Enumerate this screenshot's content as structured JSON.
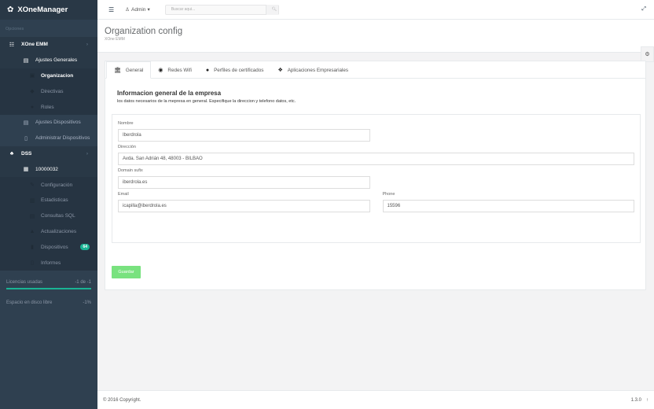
{
  "app": {
    "name": "XOneManager"
  },
  "sidebar": {
    "section_label": "Opciones",
    "items": [
      {
        "label": "XOne EMM"
      },
      {
        "label": "Ajustes Generales"
      },
      {
        "label": "Organizacion"
      },
      {
        "label": "Directivas"
      },
      {
        "label": "Roles"
      },
      {
        "label": "Ajustes Dispositivos"
      },
      {
        "label": "Administrar Dispositivos"
      },
      {
        "label": "DSS"
      },
      {
        "label": "10000032"
      },
      {
        "label": "Configuración"
      },
      {
        "label": "Estadisticas"
      },
      {
        "label": "Consultas SQL"
      },
      {
        "label": "Actualizaciones"
      },
      {
        "label": "Dispositivos",
        "badge": "64"
      },
      {
        "label": "Informes"
      }
    ],
    "stats": [
      {
        "label": "Licencias usadas",
        "value": "-1 de -1"
      },
      {
        "label": "Espacio en disco libre",
        "value": "-1%"
      }
    ]
  },
  "topbar": {
    "user": "Admin",
    "search_placeholder": "Buscar aqui..."
  },
  "page": {
    "title": "Organization config",
    "breadcrumb": "XOne EMM"
  },
  "tabs": [
    {
      "label": "General"
    },
    {
      "label": "Redes Wifi"
    },
    {
      "label": "Perfiles de certificados"
    },
    {
      "label": "Aplicaciones Empresariales"
    }
  ],
  "form": {
    "title": "Informacion general de la empresa",
    "description": "los datos necesarios de la mepresa en general. Especifique la direccion y telefono datos, etc.",
    "nombre": {
      "label": "Nombre",
      "value": "Iberdrola"
    },
    "direccion": {
      "label": "Dirección",
      "value": "Avda. San Adrián 48, 48003 - BILBAO"
    },
    "domain": {
      "label": "Domain sufix",
      "value": "iberdrola.es"
    },
    "email": {
      "label": "Email",
      "value": "icapilla@iberdrola.es"
    },
    "phone": {
      "label": "Phone",
      "value": "15596"
    },
    "save_label": "Guardar"
  },
  "footer": {
    "copyright": "© 2016 Copyright.",
    "version": "1.3.0"
  }
}
